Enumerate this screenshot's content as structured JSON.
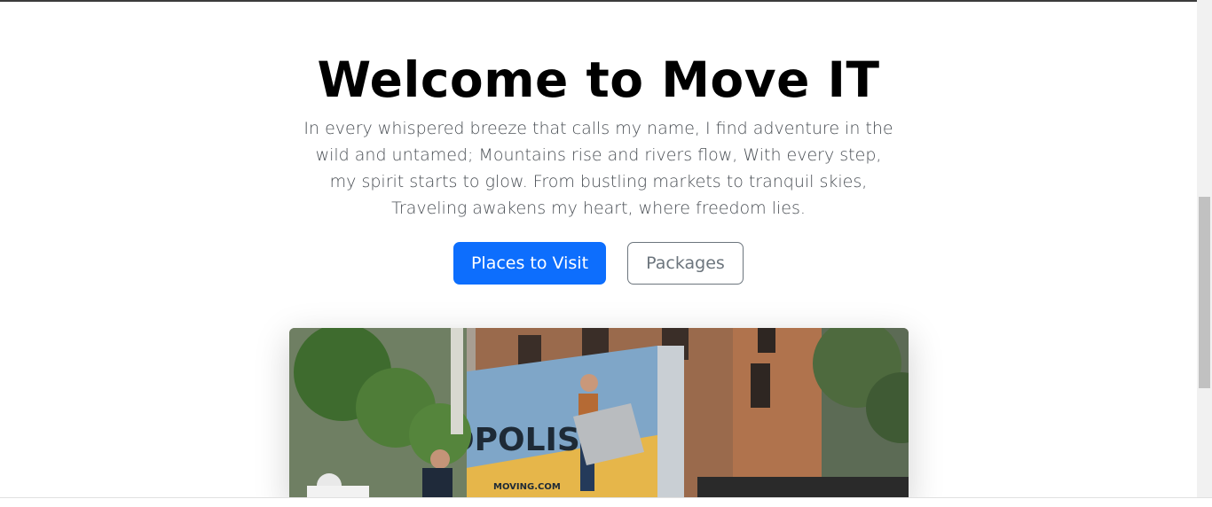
{
  "hero": {
    "title": "Welcome to Move IT",
    "text": "In every whispered breeze that calls my name, I find adventure in the wild and untamed; Mountains rise and rivers flow, With every step, my spirit starts to glow. From bustling markets to tranquil skies, Traveling awakens my heart, where freedom lies.",
    "primary_button": "Places to Visit",
    "secondary_button": "Packages"
  },
  "photo": {
    "truck_text": "OPOLIS",
    "truck_sub_text": "MOVING.COM"
  },
  "colors": {
    "primary": "#0d6efd",
    "secondary": "#6c757d"
  }
}
